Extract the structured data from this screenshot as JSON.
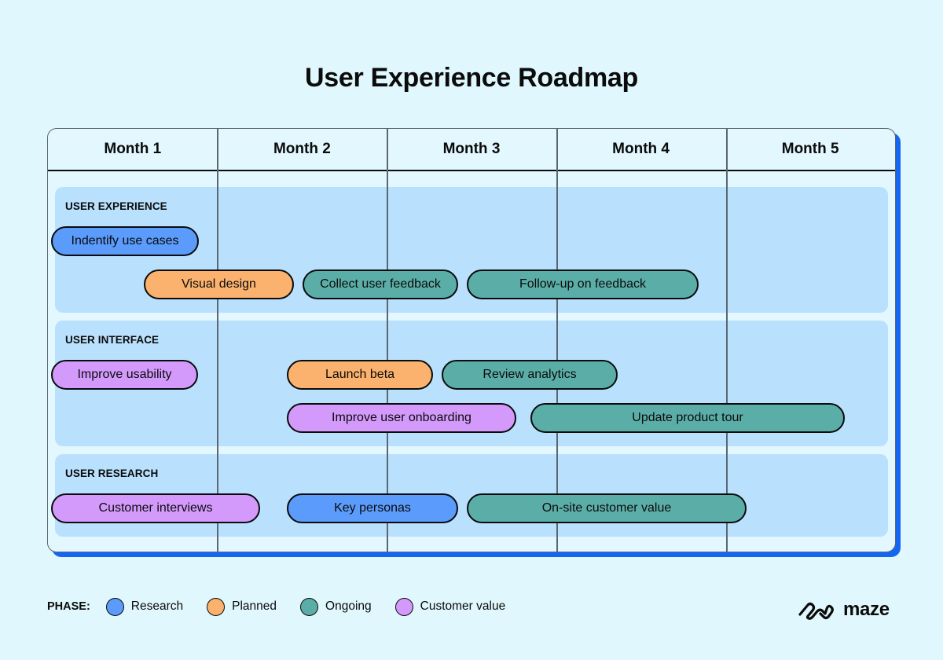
{
  "title": "User Experience Roadmap",
  "months": [
    "Month 1",
    "Month 2",
    "Month 3",
    "Month 4",
    "Month 5"
  ],
  "phase_colors": {
    "research": "#5b9bfb",
    "planned": "#fbb26e",
    "ongoing": "#5baea8",
    "customer_value": "#d39afb"
  },
  "groups": [
    {
      "label": "USER EXPERIENCE",
      "tasks": [
        {
          "label": "Indentify use cases",
          "phase": "research"
        },
        {
          "label": "Visual design",
          "phase": "planned"
        },
        {
          "label": "Collect user feedback",
          "phase": "ongoing"
        },
        {
          "label": "Follow-up on feedback",
          "phase": "ongoing"
        }
      ]
    },
    {
      "label": "USER INTERFACE",
      "tasks": [
        {
          "label": "Improve usability",
          "phase": "customer_value"
        },
        {
          "label": "Launch beta",
          "phase": "planned"
        },
        {
          "label": "Review analytics",
          "phase": "ongoing"
        },
        {
          "label": "Improve user onboarding",
          "phase": "customer_value"
        },
        {
          "label": "Update product tour",
          "phase": "ongoing"
        }
      ]
    },
    {
      "label": "USER RESEARCH",
      "tasks": [
        {
          "label": "Customer interviews",
          "phase": "customer_value"
        },
        {
          "label": "Key personas",
          "phase": "research"
        },
        {
          "label": "On-site customer value",
          "phase": "ongoing"
        }
      ]
    }
  ],
  "legend": {
    "title": "PHASE:",
    "items": [
      {
        "label": "Research",
        "phase": "research"
      },
      {
        "label": "Planned",
        "phase": "planned"
      },
      {
        "label": "Ongoing",
        "phase": "ongoing"
      },
      {
        "label": "Customer value",
        "phase": "customer_value"
      }
    ]
  },
  "brand": {
    "name": "maze",
    "icon": "maze-logo-icon"
  }
}
